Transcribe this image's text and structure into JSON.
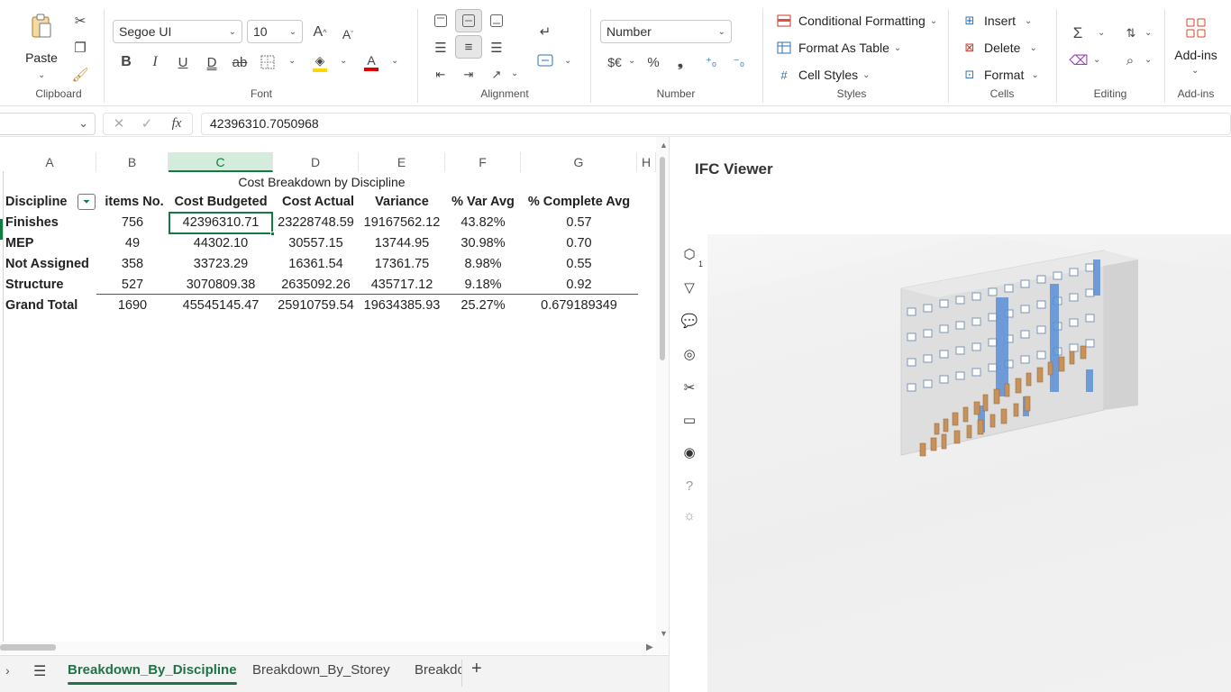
{
  "ribbon": {
    "clipboard": {
      "paste_label": "Paste",
      "group_label": "Clipboard"
    },
    "font": {
      "name": "Segoe UI",
      "size": "10",
      "group_label": "Font"
    },
    "alignment": {
      "group_label": "Alignment"
    },
    "number": {
      "format": "Number",
      "currency_label": "$€",
      "group_label": "Number"
    },
    "styles": {
      "conditional_formatting": "Conditional Formatting",
      "format_as_table": "Format As Table",
      "cell_styles": "Cell Styles",
      "group_label": "Styles"
    },
    "cells": {
      "insert": "Insert",
      "delete": "Delete",
      "format": "Format",
      "group_label": "Cells"
    },
    "editing": {
      "group_label": "Editing"
    },
    "addins": {
      "label": "Add-ins",
      "group_label": "Add-ins"
    }
  },
  "formula_bar": {
    "value": "42396310.7050968"
  },
  "sheet": {
    "columns": [
      "A",
      "B",
      "C",
      "D",
      "E",
      "F",
      "G",
      "H"
    ],
    "title": "Cost Breakdown by Discipline",
    "headers": [
      "Discipline",
      "items No.",
      "Cost Budgeted",
      "Cost Actual",
      "Variance",
      "% Var Avg",
      "% Complete Avg"
    ],
    "rows": [
      [
        "Finishes",
        "756",
        "42396310.71",
        "23228748.59",
        "19167562.12",
        "43.82%",
        "0.57"
      ],
      [
        "MEP",
        "49",
        "44302.10",
        "30557.15",
        "13744.95",
        "30.98%",
        "0.70"
      ],
      [
        "Not Assigned",
        "358",
        "33723.29",
        "16361.54",
        "17361.75",
        "8.98%",
        "0.55"
      ],
      [
        "Structure",
        "527",
        "3070809.38",
        "2635092.26",
        "435717.12",
        "9.18%",
        "0.92"
      ]
    ],
    "total": [
      "Grand Total",
      "1690",
      "45545145.47",
      "25910759.54",
      "19634385.93",
      "25.27%",
      "0.679189349"
    ]
  },
  "tabs": [
    "Breakdown_By_Discipline",
    "Breakdown_By_Storey",
    "Breakdown"
  ],
  "viewer": {
    "title": "IFC Viewer",
    "model_badge": "1"
  },
  "colors": {
    "accent_green": "#217346",
    "selection_green": "#107c41"
  }
}
